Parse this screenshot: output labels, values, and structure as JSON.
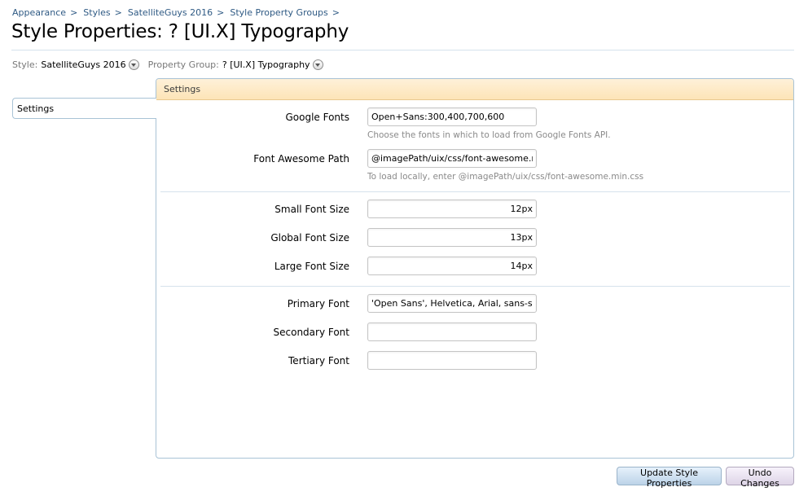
{
  "breadcrumb": [
    {
      "label": "Appearance",
      "sep": ">"
    },
    {
      "label": "Styles",
      "sep": ">"
    },
    {
      "label": "SatelliteGuys 2016",
      "sep": ">"
    },
    {
      "label": "Style Property Groups",
      "sep": ">"
    }
  ],
  "page": {
    "title": "Style Properties: ? [UI.X] Typography"
  },
  "meta": {
    "style_label": "Style:",
    "style_value": "SatelliteGuys 2016",
    "group_label": "Property Group:",
    "group_value": "? [UI.X] Typography"
  },
  "tabs": [
    {
      "label": "Settings"
    }
  ],
  "panel": {
    "header": "Settings"
  },
  "fields": {
    "google_fonts": {
      "label": "Google Fonts",
      "value": "Open+Sans:300,400,700,600",
      "hint": "Choose the fonts in which to load from Google Fonts API."
    },
    "font_awesome": {
      "label": "Font Awesome Path",
      "value": "@imagePath/uix/css/font-awesome.min.css",
      "hint": "To load locally, enter @imagePath/uix/css/font-awesome.min.css"
    },
    "small_font": {
      "label": "Small Font Size",
      "value": "12px"
    },
    "global_font": {
      "label": "Global Font Size",
      "value": "13px"
    },
    "large_font": {
      "label": "Large Font Size",
      "value": "14px"
    },
    "primary_font": {
      "label": "Primary Font",
      "value": "'Open Sans', Helvetica, Arial, sans-serif"
    },
    "secondary_font": {
      "label": "Secondary Font",
      "value": ""
    },
    "tertiary_font": {
      "label": "Tertiary Font",
      "value": ""
    }
  },
  "buttons": {
    "update": "Update Style Properties",
    "undo": "Undo Changes"
  },
  "colors": {
    "panel_header_bg": "#fde4b7",
    "link": "#2f5a84",
    "border": "#a9c3d6"
  }
}
